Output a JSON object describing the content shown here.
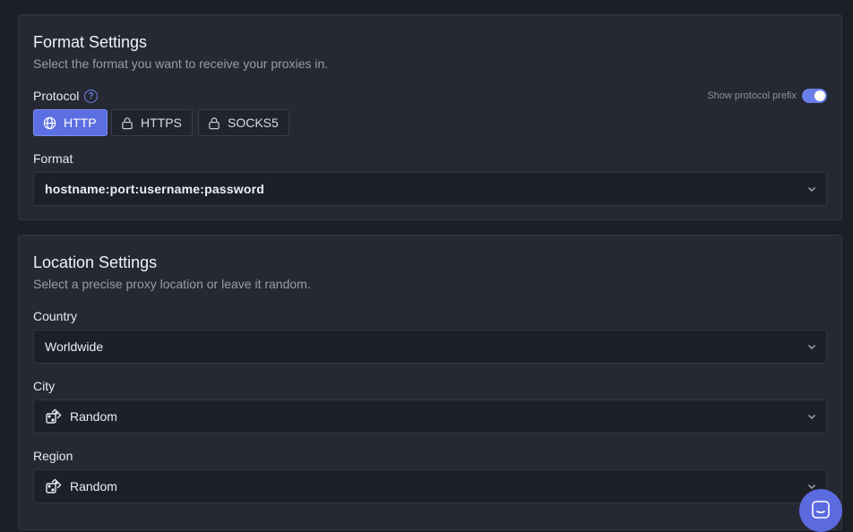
{
  "format_settings": {
    "title": "Format Settings",
    "subtitle": "Select the format you want to receive your proxies in.",
    "protocol_label": "Protocol",
    "help_glyph": "?",
    "show_prefix_label": "Show protocol prefix",
    "show_prefix_enabled": true,
    "protocols": [
      {
        "label": "HTTP",
        "icon": "globe-icon",
        "selected": true
      },
      {
        "label": "HTTPS",
        "icon": "lock-icon",
        "selected": false
      },
      {
        "label": "SOCKS5",
        "icon": "lock-icon",
        "selected": false
      }
    ],
    "format_label": "Format",
    "format_value": "hostname:port:username:password"
  },
  "location_settings": {
    "title": "Location Settings",
    "subtitle": "Select a precise proxy location or leave it random.",
    "country_label": "Country",
    "country_value": "Worldwide",
    "city_label": "City",
    "city_value": "Random",
    "city_icon": "dice-icon",
    "region_label": "Region",
    "region_value": "Random",
    "region_icon": "dice-icon"
  },
  "colors": {
    "accent": "#5b6fe3",
    "card_bg": "#262833",
    "page_bg": "#1d1f27"
  },
  "chat_widget_icon": "chat-icon"
}
